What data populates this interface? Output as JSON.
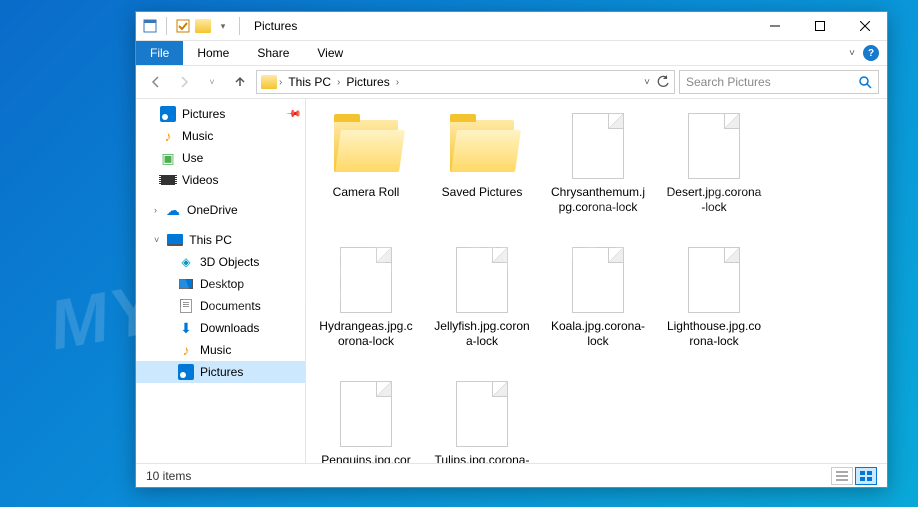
{
  "watermark": "MYANTISPYWARE.COM",
  "window": {
    "title": "Pictures"
  },
  "ribbon": {
    "file": "File",
    "home": "Home",
    "share": "Share",
    "view": "View"
  },
  "breadcrumb": {
    "seg1": "This PC",
    "seg2": "Pictures"
  },
  "search": {
    "placeholder": "Search Pictures"
  },
  "nav": {
    "pictures": "Pictures",
    "music": "Music",
    "use": "Use",
    "videos": "Videos",
    "onedrive": "OneDrive",
    "thispc": "This PC",
    "objects3d": "3D Objects",
    "desktop": "Desktop",
    "documents": "Documents",
    "downloads": "Downloads",
    "music2": "Music",
    "pictures2": "Pictures"
  },
  "files": [
    {
      "name": "Camera Roll",
      "type": "folder"
    },
    {
      "name": "Saved Pictures",
      "type": "folder"
    },
    {
      "name": "Chrysanthemum.jpg.corona-lock",
      "type": "file"
    },
    {
      "name": "Desert.jpg.corona-lock",
      "type": "file"
    },
    {
      "name": "Hydrangeas.jpg.corona-lock",
      "type": "file"
    },
    {
      "name": "Jellyfish.jpg.corona-lock",
      "type": "file"
    },
    {
      "name": "Koala.jpg.corona-lock",
      "type": "file"
    },
    {
      "name": "Lighthouse.jpg.corona-lock",
      "type": "file"
    },
    {
      "name": "Penguins.jpg.corona-lock",
      "type": "file"
    },
    {
      "name": "Tulips.jpg.corona-lock",
      "type": "file"
    }
  ],
  "status": {
    "count": "10 items"
  }
}
